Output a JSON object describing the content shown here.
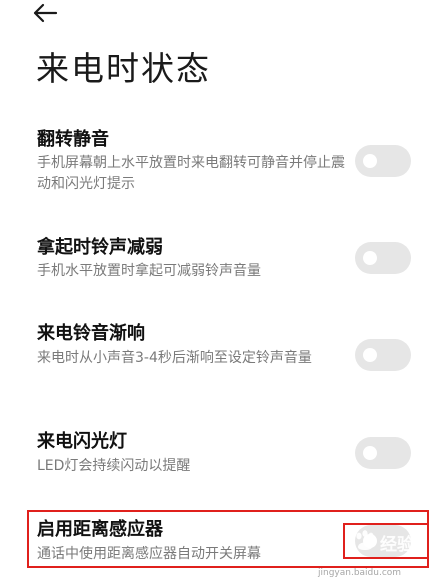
{
  "header": {
    "back_icon": "arrow-left-icon",
    "title": "来电时状态"
  },
  "settings": [
    {
      "title": "翻转静音",
      "description": "手机屏幕朝上水平放置时来电翻转可静音并停止震动和闪光灯提示",
      "enabled": false
    },
    {
      "title": "拿起时铃声减弱",
      "description": "手机水平放置时拿起可减弱铃声音量",
      "enabled": false
    },
    {
      "title": "来电铃音渐响",
      "description": "来电时从小声音3-4秒后渐响至设定铃声音量",
      "enabled": false
    },
    {
      "title": "来电闪光灯",
      "description": "LED灯会持续闪动以提醒",
      "enabled": false
    },
    {
      "title": "启用距离感应器",
      "description": "通话中使用距离感应器自动开关屏幕",
      "enabled": false
    }
  ],
  "watermark": {
    "text": "经验",
    "url": "jingyan.baidu.com",
    "icon": "paw-logo-icon"
  },
  "colors": {
    "toggle_off": "#e6e6e6",
    "highlight": "#e0201c",
    "description_text": "#7a7a7a"
  }
}
